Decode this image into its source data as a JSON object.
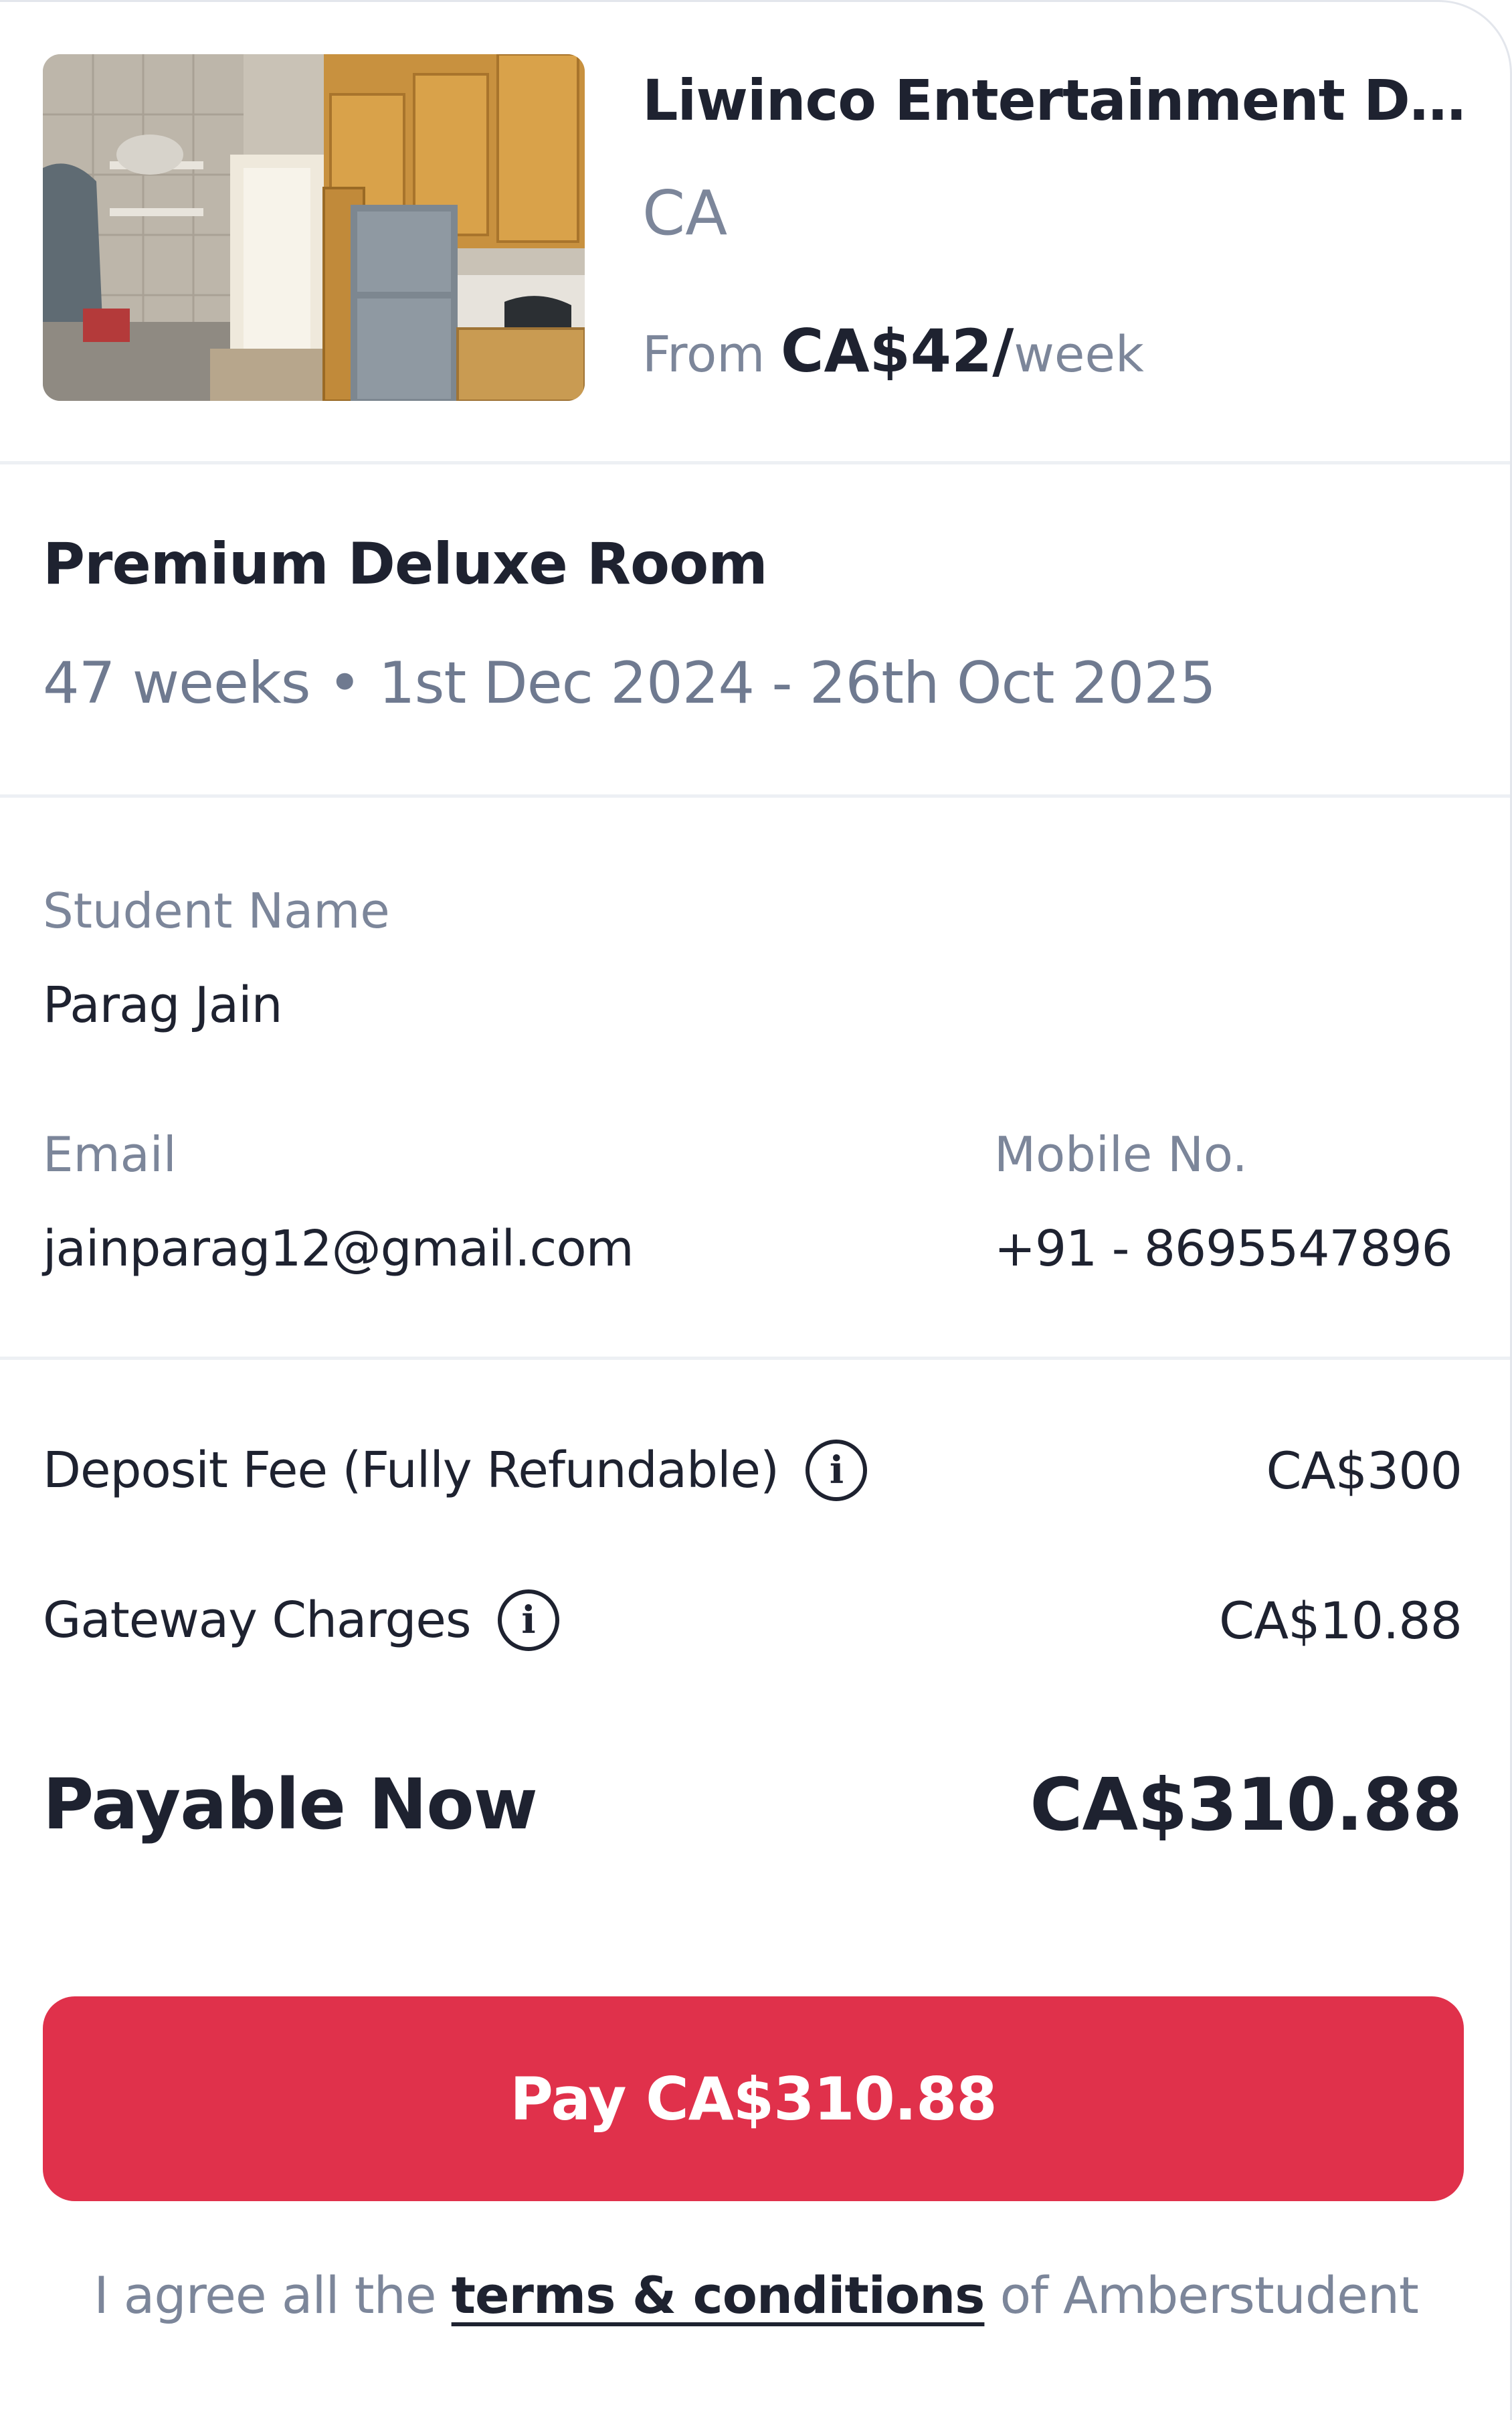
{
  "property": {
    "name": "Liwinco Entertainment Di...",
    "country": "CA",
    "price_prefix": "From ",
    "price_amount": "CA$42",
    "price_slash": "/",
    "price_unit": "week",
    "image_icon": "kitchen-photo"
  },
  "room": {
    "title": "Premium Deluxe Room",
    "duration": "47 weeks • 1st Dec 2024 - 26th Oct 2025"
  },
  "student": {
    "name_label": "Student Name",
    "name_value": "Parag Jain",
    "email_label": "Email",
    "email_value": "jainparag12@gmail.com",
    "mobile_label": "Mobile No.",
    "mobile_value": "+91 - 8695547896"
  },
  "fees": {
    "deposit_label": "Deposit Fee (Fully Refundable)",
    "deposit_value": "CA$300",
    "gateway_label": "Gateway Charges",
    "gateway_value": "CA$10.88",
    "info_icon": "info-icon",
    "info_glyph": "i"
  },
  "total": {
    "label": "Payable Now",
    "value": "CA$310.88"
  },
  "pay_button": {
    "label": "Pay CA$310.88",
    "color": "#e0314b"
  },
  "terms": {
    "prefix": "I agree all the ",
    "link": "terms & conditions",
    "suffix": " of Amberstudent"
  }
}
